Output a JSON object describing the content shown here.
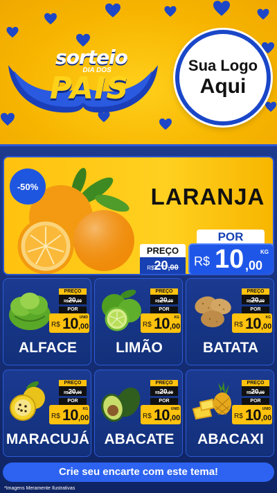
{
  "header": {
    "promo": {
      "line1": "sorteio",
      "line2": "DIA DOS",
      "line3": "PAIS"
    },
    "logo": {
      "line1": "Sua Logo",
      "line2": "Aqui"
    }
  },
  "featured": {
    "discount": "-50%",
    "name": "LARANJA",
    "preco_label": "PREÇO",
    "old_currency": "R$",
    "old_int": "20",
    "old_cents": ",00",
    "por_label": "POR",
    "new_currency": "R$",
    "new_int": "10",
    "new_cents": ",00",
    "unit": "KG",
    "icon": "orange-icon"
  },
  "products": [
    {
      "name": "ALFACE",
      "preco_label": "PREÇO",
      "old_currency": "R$",
      "old_int": "20",
      "old_cents": ",00",
      "por_label": "POR",
      "new_currency": "R$",
      "new_int": "10",
      "new_cents": ",00",
      "unit": "UNID",
      "icon": "lettuce-icon"
    },
    {
      "name": "LIMÃO",
      "preco_label": "PREÇO",
      "old_currency": "R$",
      "old_int": "20",
      "old_cents": ",00",
      "por_label": "POR",
      "new_currency": "R$",
      "new_int": "10",
      "new_cents": ",00",
      "unit": "KG",
      "icon": "lime-icon"
    },
    {
      "name": "BATATA",
      "preco_label": "PREÇO",
      "old_currency": "R$",
      "old_int": "20",
      "old_cents": ",00",
      "por_label": "POR",
      "new_currency": "R$",
      "new_int": "10",
      "new_cents": ",00",
      "unit": "KG",
      "icon": "potato-icon"
    },
    {
      "name": "MARACUJÁ",
      "preco_label": "PREÇO",
      "old_currency": "R$",
      "old_int": "20",
      "old_cents": ",00",
      "por_label": "POR",
      "new_currency": "R$",
      "new_int": "10",
      "new_cents": ",00",
      "unit": "KG",
      "icon": "passion-fruit-icon"
    },
    {
      "name": "ABACATE",
      "preco_label": "PREÇO",
      "old_currency": "R$",
      "old_int": "20",
      "old_cents": ",00",
      "por_label": "POR",
      "new_currency": "R$",
      "new_int": "10",
      "new_cents": ",00",
      "unit": "UNID",
      "icon": "avocado-icon"
    },
    {
      "name": "ABACAXI",
      "preco_label": "PREÇO",
      "old_currency": "R$",
      "old_int": "20",
      "old_cents": ",00",
      "por_label": "POR",
      "new_currency": "R$",
      "new_int": "10",
      "new_cents": ",00",
      "unit": "UNID",
      "icon": "pineapple-icon"
    }
  ],
  "footer": {
    "cta": "Crie seu encarte com este tema!",
    "disclaimer": "*Imagens Meramente Ilustrativas"
  },
  "colors": {
    "brand_yellow": "#ffc20e",
    "brand_blue": "#1e56e8",
    "panel_blue": "#1d3a8e"
  }
}
